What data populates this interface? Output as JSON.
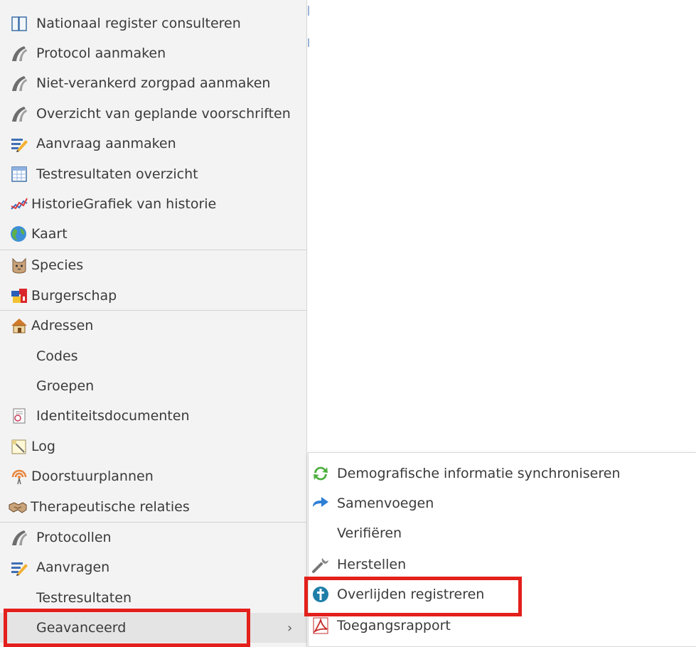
{
  "menu": {
    "items": [
      {
        "label": "Nationaal register consulteren",
        "icon": "book-icon"
      },
      {
        "label": "Protocol aanmaken",
        "icon": "road-icon"
      },
      {
        "label": "Niet-verankerd zorgpad aanmaken",
        "icon": "road-icon"
      },
      {
        "label": "Overzicht van geplande voorschriften",
        "icon": "road-icon"
      },
      {
        "label": "Aanvraag aanmaken",
        "icon": "pencil-paper-icon"
      },
      {
        "label": "Testresultaten overzicht",
        "icon": "table-icon"
      },
      {
        "label": "HistorieGrafiek van historie",
        "icon": "line-chart-icon"
      },
      {
        "label": "Kaart",
        "icon": "globe-icon"
      },
      {
        "label": "Species",
        "icon": "cat-icon"
      },
      {
        "label": "Burgerschap",
        "icon": "flags-icon"
      },
      {
        "label": "Adressen",
        "icon": "house-icon"
      },
      {
        "label": "Codes",
        "icon": ""
      },
      {
        "label": "Groepen",
        "icon": ""
      },
      {
        "label": "Identiteitsdocumenten",
        "icon": "id-document-icon"
      },
      {
        "label": "Log",
        "icon": "log-icon"
      },
      {
        "label": "Doorstuurplannen",
        "icon": "broadcast-icon"
      },
      {
        "label": "Therapeutische relaties",
        "icon": "handshake-icon"
      },
      {
        "label": "Protocollen",
        "icon": "road-icon"
      },
      {
        "label": "Aanvragen",
        "icon": "pencil-paper-icon"
      },
      {
        "label": "Testresultaten",
        "icon": ""
      },
      {
        "label": "Geavanceerd",
        "icon": "",
        "has_submenu": true,
        "chevron": "›"
      }
    ]
  },
  "submenu": {
    "items": [
      {
        "label": "Demografische informatie synchroniseren",
        "icon": "sync-icon"
      },
      {
        "label": "Samenvoegen",
        "icon": "merge-arrow-icon"
      },
      {
        "label": "Verifiëren",
        "icon": ""
      },
      {
        "label": "Herstellen",
        "icon": "wrench-icon"
      },
      {
        "label": "Overlijden registreren",
        "icon": "cross-badge-icon"
      },
      {
        "label": "Toegangsrapport",
        "icon": "pdf-icon"
      }
    ]
  },
  "colors": {
    "highlight": "#e3201b",
    "menu_background": "#f3f3f3",
    "hover_background": "#e4e4e4",
    "text": "#3a3a3a"
  }
}
